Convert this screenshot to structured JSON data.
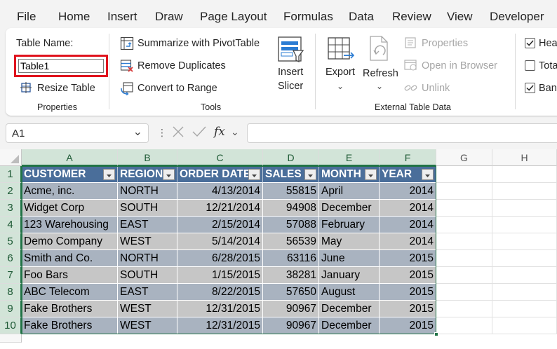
{
  "menu": {
    "tabs": [
      "File",
      "Home",
      "Insert",
      "Draw",
      "Page Layout",
      "Formulas",
      "Data",
      "Review",
      "View",
      "Developer"
    ]
  },
  "ribbon": {
    "properties": {
      "table_name_label": "Table Name:",
      "table_name_value": "Table1",
      "resize_table": "Resize Table",
      "group_label": "Properties"
    },
    "tools": {
      "summarize": "Summarize with PivotTable",
      "remove_duplicates": "Remove Duplicates",
      "convert_to_range": "Convert to Range",
      "insert_slicer_line1": "Insert",
      "insert_slicer_line2": "Slicer",
      "group_label": "Tools"
    },
    "external": {
      "export": "Export",
      "refresh": "Refresh",
      "properties": "Properties",
      "open_in_browser": "Open in Browser",
      "unlink": "Unlink",
      "group_label": "External Table Data"
    },
    "style_options": {
      "header_row": {
        "label": "Hea",
        "checked": true
      },
      "total_row": {
        "label": "Tota",
        "checked": false
      },
      "banded_rows": {
        "label": "Ban",
        "checked": true
      }
    }
  },
  "formula_bar": {
    "name_box": "A1",
    "fx": "fx",
    "formula": ""
  },
  "sheet": {
    "columns": [
      "A",
      "B",
      "C",
      "D",
      "E",
      "F",
      "G",
      "H"
    ],
    "rows": [
      "1",
      "2",
      "3",
      "4",
      "5",
      "6",
      "7",
      "8",
      "9",
      "10"
    ],
    "headers": [
      "CUSTOMER",
      "REGION",
      "ORDER DATE",
      "SALES",
      "MONTH",
      "YEAR"
    ],
    "data": [
      [
        "Acme, inc.",
        "NORTH",
        "4/13/2014",
        "55815",
        "April",
        "2014"
      ],
      [
        "Widget Corp",
        "SOUTH",
        "12/21/2014",
        "94908",
        "December",
        "2014"
      ],
      [
        "123 Warehousing",
        "EAST",
        "2/15/2014",
        "57088",
        "February",
        "2014"
      ],
      [
        "Demo Company",
        "WEST",
        "5/14/2014",
        "56539",
        "May",
        "2014"
      ],
      [
        "Smith and Co.",
        "NORTH",
        "6/28/2015",
        "63116",
        "June",
        "2015"
      ],
      [
        "Foo Bars",
        "SOUTH",
        "1/15/2015",
        "38281",
        "January",
        "2015"
      ],
      [
        "ABC Telecom",
        "EAST",
        "8/22/2015",
        "57650",
        "August",
        "2015"
      ],
      [
        "Fake Brothers",
        "WEST",
        "12/31/2015",
        "90967",
        "December",
        "2015"
      ],
      [
        "Fake Brothers",
        "WEST",
        "12/31/2015",
        "90967",
        "December",
        "2015"
      ]
    ],
    "colors": {
      "header_bg": "#4a6e9a",
      "band_dark": "#a9b3c0",
      "band_light": "#c6c6c6",
      "selection": "#217346",
      "highlight_box": "#e0141e"
    }
  }
}
